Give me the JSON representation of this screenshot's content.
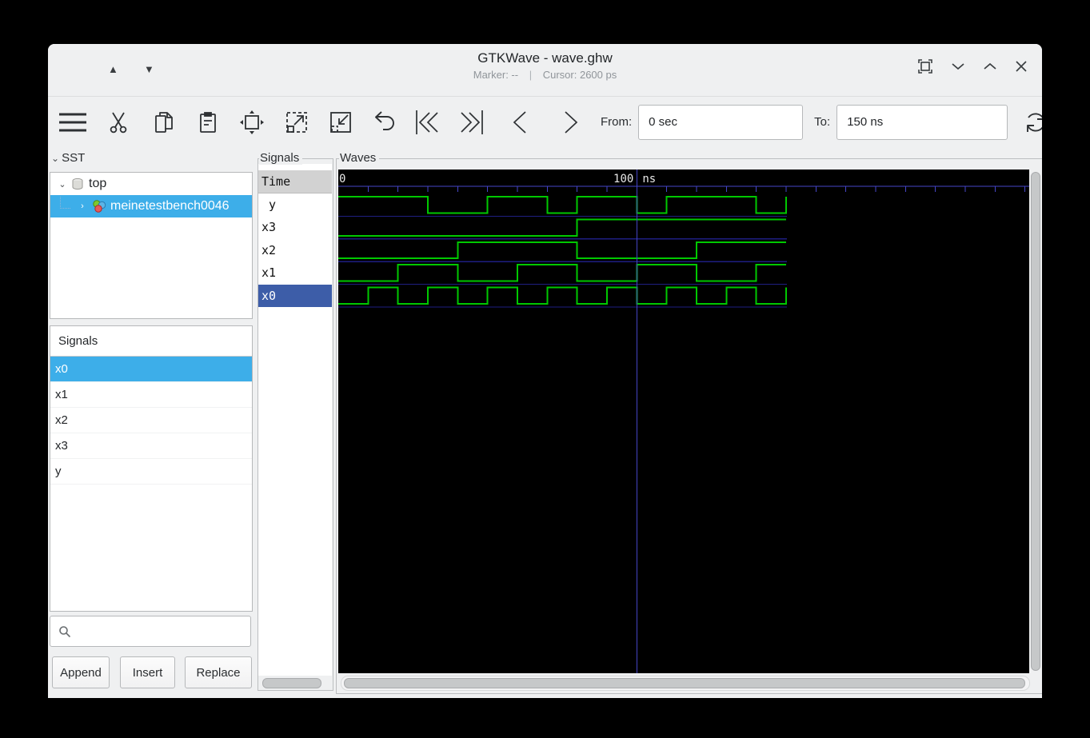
{
  "window": {
    "title": "GTKWave - wave.ghw",
    "marker_text": "Marker: --",
    "separator": "|",
    "cursor_text": "Cursor: 2600 ps"
  },
  "toolbar": {
    "from_label": "From:",
    "from_value": "0 sec",
    "to_label": "To:",
    "to_value": "150 ns"
  },
  "sst": {
    "header": "SST",
    "nodes": [
      {
        "label": "top",
        "expanded": true
      },
      {
        "label": "meinetestbench0046",
        "selected": true
      }
    ]
  },
  "signal_browser": {
    "header": "Signals",
    "items": [
      "x0",
      "x1",
      "x2",
      "x3",
      "y"
    ],
    "selected_item": "x0",
    "search_value": "",
    "buttons": {
      "append": "Append",
      "insert": "Insert",
      "replace": "Replace"
    }
  },
  "names_panel": {
    "frame_label": "Signals",
    "time_header": "Time",
    "rows": [
      " y",
      "x3",
      "x2",
      "x1",
      "x0"
    ],
    "selected_row": "x0"
  },
  "waves": {
    "frame_label": "Waves",
    "ruler_labels": {
      "zero": "0",
      "hundred": "100",
      "unit": "ns"
    },
    "chart_data": {
      "type": "line",
      "subtype": "digital-waveform",
      "time_unit": "ns",
      "xlim": [
        0,
        150
      ],
      "tick_interval": 10,
      "cursor_time": 100,
      "colors": {
        "trace": "#00c800",
        "ruler": "#4646c8",
        "baseline": "#1e1e82",
        "cursor": "#4444c4",
        "background": "#000000",
        "label": "#e8e8e8"
      },
      "signals": [
        {
          "name": "y",
          "initial": 1,
          "transitions": [
            30,
            50,
            70,
            80,
            100,
            110,
            140,
            150
          ]
        },
        {
          "name": "x3",
          "initial": 0,
          "transitions": [
            80
          ]
        },
        {
          "name": "x2",
          "initial": 0,
          "transitions": [
            40,
            80,
            120
          ]
        },
        {
          "name": "x1",
          "initial": 0,
          "transitions": [
            20,
            40,
            60,
            80,
            100,
            120,
            140
          ]
        },
        {
          "name": "x0",
          "initial": 0,
          "transitions": [
            10,
            20,
            30,
            40,
            50,
            60,
            70,
            80,
            90,
            100,
            110,
            120,
            130,
            140,
            150
          ]
        }
      ]
    }
  }
}
